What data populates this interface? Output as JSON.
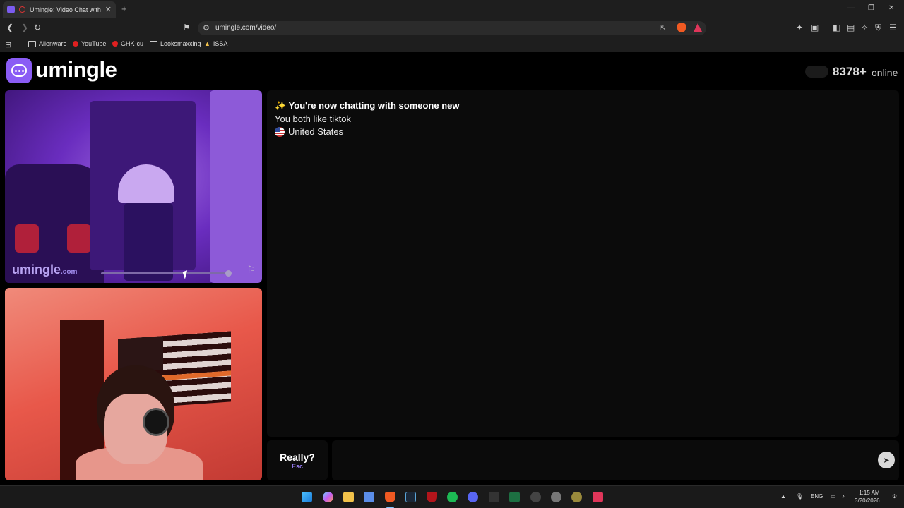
{
  "browser": {
    "tab_title": "Umingle: Video Chat with Strangers",
    "tab_close": "✕",
    "new_tab": "+",
    "url": "umingle.com/video/",
    "bookmarks": [
      {
        "label": "Alienware",
        "icon": "folder-icon"
      },
      {
        "label": "YouTube",
        "icon": "youtube-icon"
      },
      {
        "label": "GHK-cu",
        "icon": "youtube-icon"
      },
      {
        "label": "Looksmaxxing",
        "icon": "folder-icon"
      },
      {
        "label": "ISSA",
        "icon": "issa-icon"
      }
    ]
  },
  "header": {
    "logo_text": "umingle",
    "online_count": "8378+",
    "online_label": "online"
  },
  "stranger_video": {
    "watermark_main": "umingle",
    "watermark_suffix": ".com"
  },
  "chat": {
    "intro": "✨ You're now chatting with someone new",
    "interest": "You both like tiktok",
    "country": "United States"
  },
  "controls": {
    "skip_label": "Really?",
    "skip_hint": "Esc",
    "message_placeholder": "",
    "send_icon": "send-icon"
  },
  "taskbar": {
    "language": "ENG",
    "time": "1:15 AM",
    "date": "3/20/2026"
  },
  "colors": {
    "accent": "#8a5cf5",
    "page_bg": "#000000",
    "panel_bg": "#0b0b0b"
  }
}
